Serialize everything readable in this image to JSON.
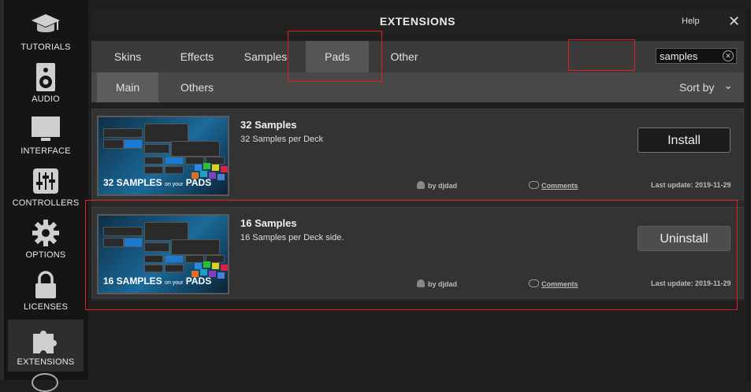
{
  "sidebar": {
    "items": [
      {
        "label": "TUTORIALS",
        "icon": "graduation-cap-icon"
      },
      {
        "label": "AUDIO",
        "icon": "speaker-icon"
      },
      {
        "label": "INTERFACE",
        "icon": "monitor-icon"
      },
      {
        "label": "CONTROLLERS",
        "icon": "sliders-icon"
      },
      {
        "label": "OPTIONS",
        "icon": "gear-icon"
      },
      {
        "label": "LICENSES",
        "icon": "lock-icon"
      },
      {
        "label": "EXTENSIONS",
        "icon": "puzzle-icon"
      }
    ],
    "active": "EXTENSIONS"
  },
  "header": {
    "title": "EXTENSIONS",
    "help": "Help",
    "close": "✕"
  },
  "tabs": [
    {
      "label": "Skins"
    },
    {
      "label": "Effects"
    },
    {
      "label": "Samples"
    },
    {
      "label": "Pads"
    },
    {
      "label": "Other"
    }
  ],
  "active_tab": "Pads",
  "search": {
    "value": "samples",
    "clear": "✕"
  },
  "subtabs": [
    {
      "label": "Main"
    },
    {
      "label": "Others"
    }
  ],
  "active_subtab": "Main",
  "sort": {
    "label": "Sort by",
    "chevron": "⌄"
  },
  "extensions": [
    {
      "title": "32 Samples",
      "description": "32 Samples per Deck",
      "thumb_caption": "32 SAMPLES",
      "thumb_small": "on your",
      "thumb_caption2": "PADS",
      "button": "Install",
      "author": "by djdad",
      "comments": "Comments",
      "last_update": "Last update: 2019-11-29"
    },
    {
      "title": "16 Samples",
      "description": "16 Samples per Deck side.",
      "thumb_caption": "16 SAMPLES",
      "thumb_small": "on your",
      "thumb_caption2": "PADS",
      "button": "Uninstall",
      "author": "by djdad",
      "comments": "Comments",
      "last_update": "Last update: 2019-11-29"
    }
  ],
  "colors": {
    "accent_red": "#e02020",
    "background": "#1f1f1f"
  }
}
